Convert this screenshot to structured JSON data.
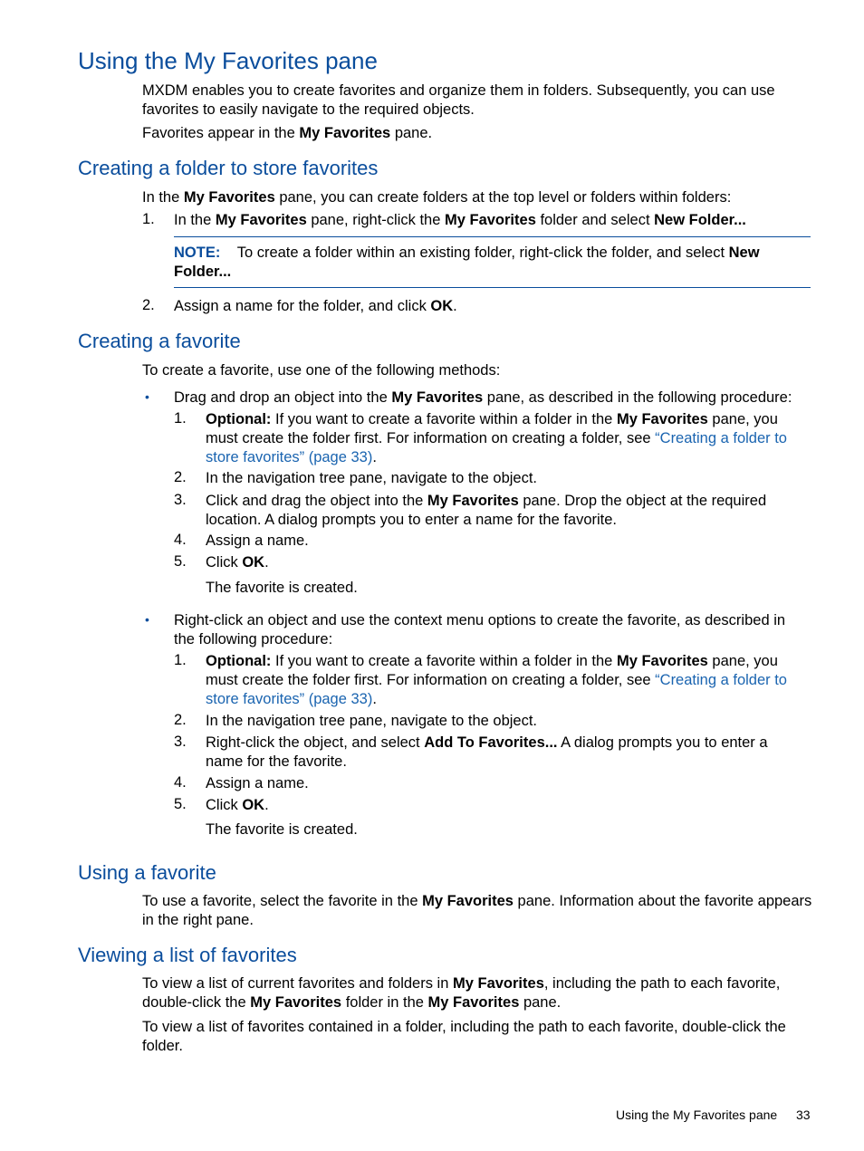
{
  "title": "Using the My Favorites pane",
  "intro": {
    "p1": "MXDM enables you to create favorites and organize them in folders. Subsequently, you can use favorites to easily navigate to the required objects.",
    "p2_pre": "Favorites appear in the ",
    "p2_bold": "My Favorites",
    "p2_post": " pane."
  },
  "sec_folder": {
    "heading": "Creating a folder to store favorites",
    "intro_pre": "In the ",
    "intro_bold": "My Favorites",
    "intro_post": " pane, you can create folders at the top level or folders within folders:",
    "step1_num": "1.",
    "step1_a": "In the ",
    "step1_b": "My Favorites",
    "step1_c": " pane, right-click the ",
    "step1_d": "My Favorites",
    "step1_e": " folder and select ",
    "step1_f": "New Folder...",
    "note_label": "NOTE:",
    "note_text": "To create a folder within an existing folder, right-click the folder, and select ",
    "note_bold": "New Folder...",
    "step2_num": "2.",
    "step2_text": "Assign a name for the folder, and click ",
    "step2_bold": "OK",
    "step2_end": "."
  },
  "sec_create": {
    "heading": "Creating a favorite",
    "intro": "To create a favorite, use one of the following methods:",
    "bullet_glyph": "•",
    "b1_pre": "Drag and drop an object into the ",
    "b1_bold": "My Favorites",
    "b1_post": " pane, as described in the following procedure:",
    "b2_text": "Right-click an object and use the context menu options to create the favorite, as described in the following procedure:",
    "opt_label": "Optional:",
    "opt_pre": " If you want to create a favorite within a folder in the ",
    "opt_bold": "My Favorites",
    "opt_post": " pane, you must create the folder first. For information on creating a folder, see ",
    "opt_link": "“Creating a folder to store favorites” (page 33)",
    "opt_end": ".",
    "nav_step": "In the navigation tree pane, navigate to the object.",
    "drag_pre": "Click and drag the object into the ",
    "drag_bold": "My Favorites",
    "drag_post": " pane. Drop the object at the required location. A dialog prompts you to enter a name for the favorite.",
    "rc_pre": "Right-click the object, and select ",
    "rc_bold": "Add To Favorites...",
    "rc_post": " A dialog prompts you to enter a name for the favorite.",
    "assign": "Assign a name.",
    "click_pre": "Click ",
    "click_bold": "OK",
    "click_end": ".",
    "result": "The favorite is created.",
    "nums": [
      "1.",
      "2.",
      "3.",
      "4.",
      "5."
    ]
  },
  "sec_use": {
    "heading": "Using a favorite",
    "pre": "To use a favorite, select the favorite in the ",
    "bold": "My Favorites",
    "post": " pane. Information about the favorite appears in the right pane."
  },
  "sec_view": {
    "heading": "Viewing a list of favorites",
    "p1_a": "To view a list of current favorites and folders in ",
    "p1_b": "My Favorites",
    "p1_c": ", including the path to each favorite, double-click the ",
    "p1_d": "My Favorites",
    "p1_e": " folder in the ",
    "p1_f": "My Favorites",
    "p1_g": " pane.",
    "p2": "To view a list of favorites contained in a folder, including the path to each favorite, double-click the folder."
  },
  "footer": {
    "section": "Using the My Favorites pane",
    "page": "33"
  }
}
